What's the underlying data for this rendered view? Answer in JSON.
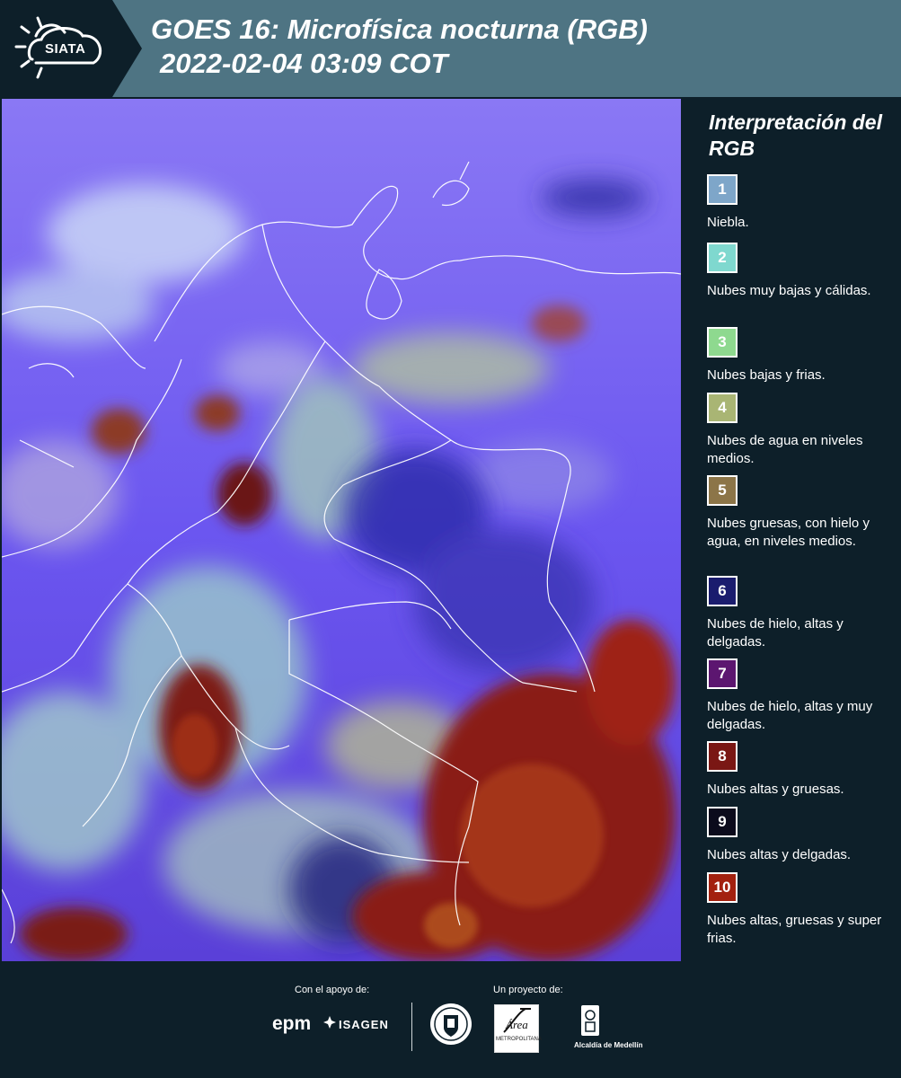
{
  "header": {
    "logo_text": "SIATA",
    "title_line1": "GOES 16: Microfísica nocturna (RGB)",
    "title_line2": "2022-02-04 03:09 COT",
    "background_color": "#4e7483"
  },
  "map": {
    "description_colors": {
      "ocean_ice_thin": "#6a58f0",
      "thick_cold": "#8a1f14",
      "low_warm": "#9fd3c8"
    }
  },
  "legend": {
    "title": "Interpretación del RGB",
    "items": [
      {
        "number": "1",
        "label": "Niebla.",
        "color": "#7ea6c9"
      },
      {
        "number": "2",
        "label": "Nubes muy bajas y cálidas.",
        "color": "#7fd8cf"
      },
      {
        "number": "3",
        "label": "Nubes bajas y frias.",
        "color": "#8ed98f"
      },
      {
        "number": "4",
        "label": "Nubes de agua en niveles medios.",
        "color": "#a9b574"
      },
      {
        "number": "5",
        "label": "Nubes gruesas, con hielo y agua, en niveles medios.",
        "color": "#8c7548"
      },
      {
        "number": "6",
        "label": "Nubes de hielo, altas y delgadas.",
        "color": "#1a1c6e"
      },
      {
        "number": "7",
        "label": "Nubes de hielo, altas y muy delgadas.",
        "color": "#5c1670"
      },
      {
        "number": "8",
        "label": "Nubes altas y gruesas.",
        "color": "#7a1714"
      },
      {
        "number": "9",
        "label": "Nubes altas y delgadas.",
        "color": "#0b0b1c"
      },
      {
        "number": "10",
        "label": "Nubes altas, gruesas y super frias.",
        "color": "#a3210f"
      }
    ]
  },
  "footer": {
    "support_label": "Con el apoyo de:",
    "project_label": "Un proyecto de:",
    "epm": "epm",
    "isagen": "ISAGEN",
    "area_logo_text": "Área",
    "area_sub_text": "METROPOLITANA",
    "alcaldia": "Alcaldía de Medellín"
  }
}
